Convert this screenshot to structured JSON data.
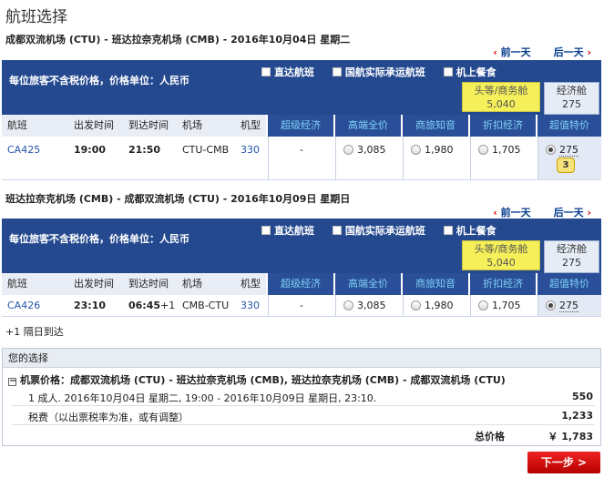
{
  "page": {
    "title": "航班选择"
  },
  "outbound": {
    "route_title": "成都双流机场 (CTU) - 班达拉奈克机场 (CMB) - 2016年10月04日 星期二",
    "prev_day": "前一天",
    "next_day": "后一天",
    "header_text": "每位旅客不含税价格，价格单位：人民币",
    "filters": [
      "直达航班",
      "国航实际承运航班",
      "机上餐食"
    ],
    "cabin_first": {
      "label": "头等/商务舱",
      "price": "5,040"
    },
    "cabin_econ": {
      "label": "经济舱",
      "price": "275"
    },
    "columns": [
      "航班",
      "出发时间",
      "到达时间",
      "机场",
      "机型"
    ],
    "fare_columns": [
      "超级经济",
      "高端全价",
      "商旅知音",
      "折扣经济",
      "超值特价"
    ],
    "flight": {
      "number": "CA425",
      "depart": "19:00",
      "arrive": "21:50",
      "airport": "CTU-CMB",
      "aircraft": "330",
      "super_economy": "-",
      "full_price": "3,085",
      "business_traveler": "1,980",
      "discount": "1,705",
      "special": "275",
      "seats_left": "3"
    }
  },
  "return": {
    "route_title": "班达拉奈克机场 (CMB) - 成都双流机场 (CTU) - 2016年10月09日 星期日",
    "prev_day": "前一天",
    "next_day": "后一天",
    "header_text": "每位旅客不含税价格，价格单位：人民币",
    "filters": [
      "直达航班",
      "国航实际承运航班",
      "机上餐食"
    ],
    "cabin_first": {
      "label": "头等/商务舱",
      "price": "5,040"
    },
    "cabin_econ": {
      "label": "经济舱",
      "price": "275"
    },
    "columns": [
      "航班",
      "出发时间",
      "到达时间",
      "机场",
      "机型"
    ],
    "fare_columns": [
      "超级经济",
      "高端全价",
      "商旅知音",
      "折扣经济",
      "超值特价"
    ],
    "flight": {
      "number": "CA426",
      "depart": "23:10",
      "arrive": "06:45",
      "arrive_suffix": "+1",
      "airport": "CMB-CTU",
      "aircraft": "330",
      "super_economy": "-",
      "full_price": "3,085",
      "business_traveler": "1,980",
      "discount": "1,705",
      "special": "275"
    }
  },
  "note": "+1 隔日到达",
  "summary": {
    "title": "您的选择",
    "ticket_line": "机票价格：成都双流机场 (CTU) - 班达拉奈克机场 (CMB), 班达拉奈克机场 (CMB) - 成都双流机场 (CTU)",
    "passenger_line": "1 成人. 2016年10月04日 星期二, 19:00 - 2016年10月09日 星期日, 23:10.",
    "passenger_amount": "550",
    "tax_line": "税费（以出票税率为准，或有调整）",
    "tax_amount": "1,233",
    "total_label": "总价格",
    "total_amount": "￥ 1,783"
  },
  "next_button": "下一步 >"
}
